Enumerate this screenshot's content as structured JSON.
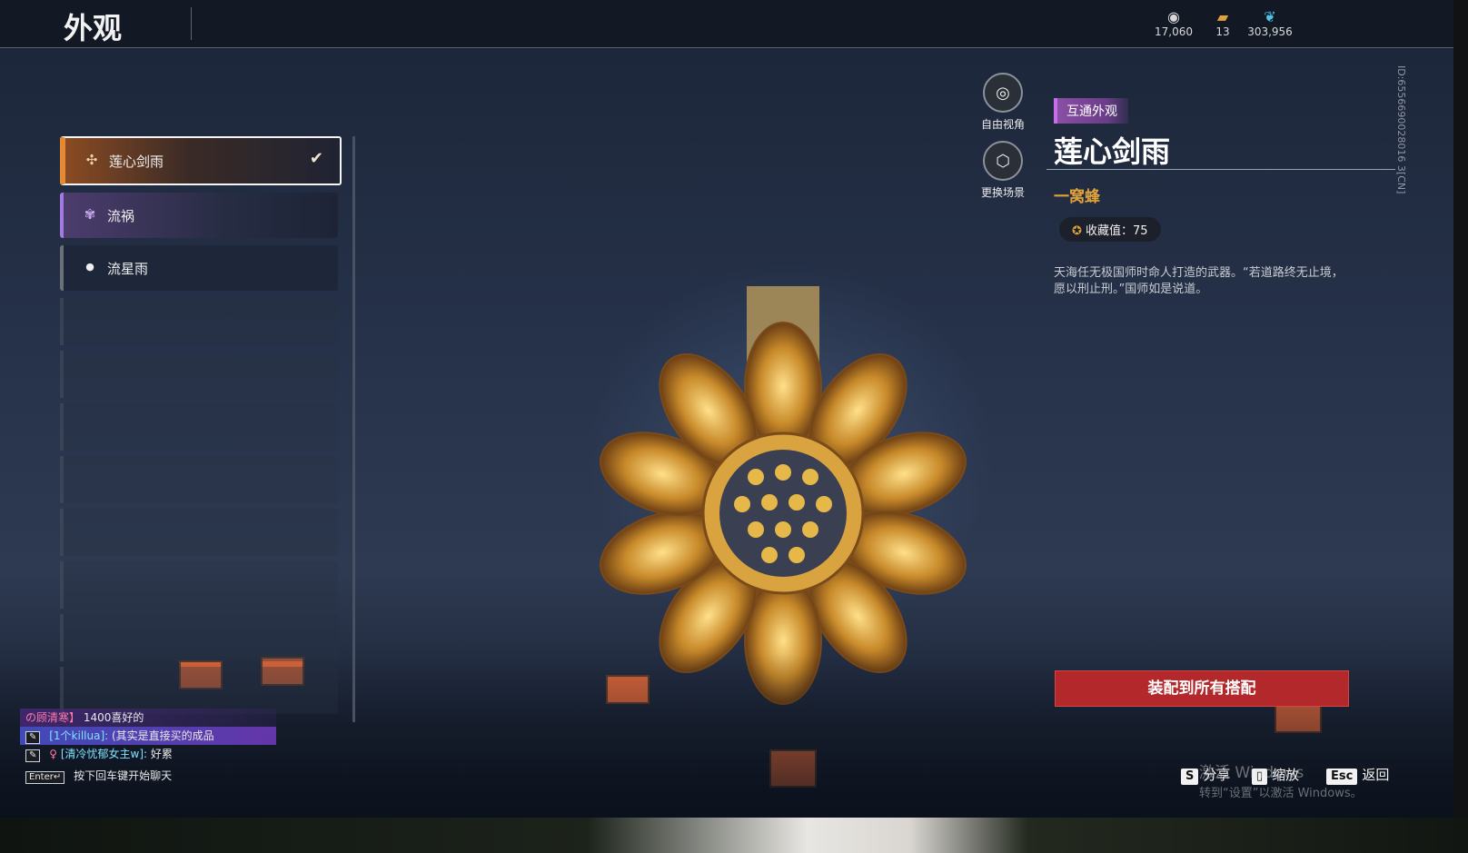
{
  "header": {
    "title": "外观"
  },
  "currencies": [
    {
      "icon": "coin-bag-icon",
      "value": "17,060"
    },
    {
      "icon": "ticket-icon",
      "value": "13"
    },
    {
      "icon": "feather-icon",
      "value": "303,956"
    }
  ],
  "list": {
    "items": [
      {
        "label": "莲心剑雨",
        "icon": "lotus-icon",
        "selected": true
      },
      {
        "label": "流祸",
        "icon": "flower-icon",
        "selected": false
      },
      {
        "label": "流星雨",
        "icon": "drop-icon",
        "selected": false
      }
    ]
  },
  "tools": {
    "free_view": "自由视角",
    "change_scene": "更换场景"
  },
  "detail": {
    "tag": "互通外观",
    "name": "莲心剑雨",
    "subtitle": "一窝蜂",
    "collect": "收藏值：75",
    "description": "天海任无极国师时命人打造的武器。“若道路终无止境，愿以刑止刑。”国师如是说道。"
  },
  "equip_button": "装配到所有搭配",
  "player_id": "ID:6556690028016 3[CN]",
  "chat": {
    "line1_name": "の顾清寒】",
    "line1_text": "1400喜好的",
    "line2_name": "[1个killua]:",
    "line2_text": "(其实是直接买的成品",
    "line3_name": "[清冷忧郁女主w]:",
    "line3_text": "好累",
    "enter_key": "Enter↵",
    "enter_hint": "按下回车键开始聊天"
  },
  "hints": {
    "share_key": "S",
    "share": "分享",
    "zoom": "缩放",
    "back_key": "Esc",
    "back": "返回"
  },
  "watermark": {
    "line1": "激活 Windows",
    "line2": "转到“设置”以激活 Windows。"
  },
  "colors": {
    "accent_orange": "#e58a34",
    "purple": "#a37ae0",
    "equip_red": "#b3282b",
    "gold": "#e0a23a"
  }
}
